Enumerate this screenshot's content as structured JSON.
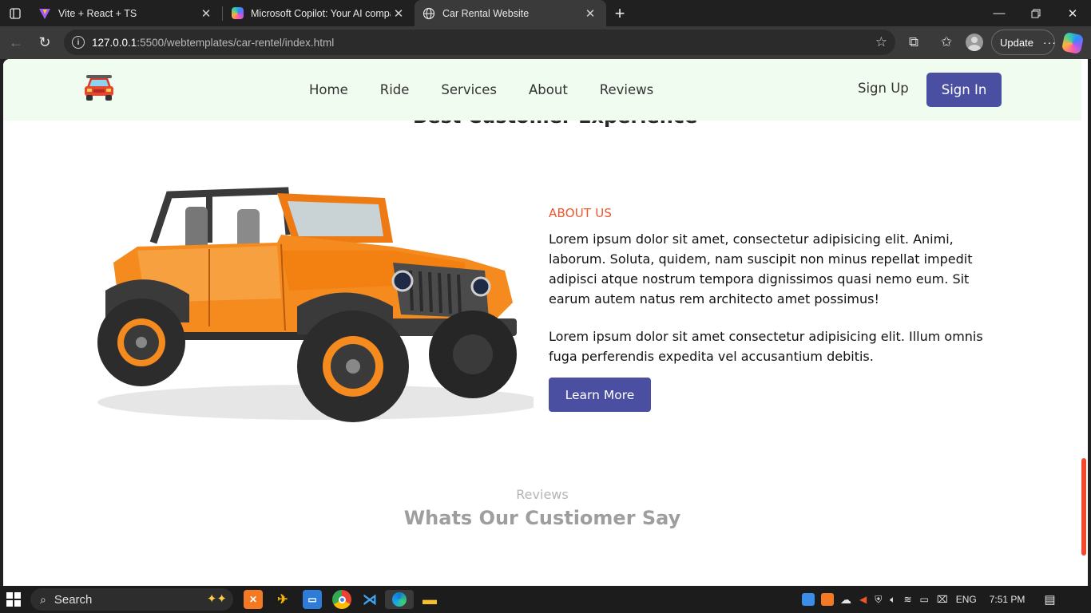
{
  "browser": {
    "tabs": [
      {
        "title": "Vite + React + TS",
        "icon": "vite-icon"
      },
      {
        "title": "Microsoft Copilot: Your AI compa",
        "icon": "copilot-icon"
      },
      {
        "title": "Car Rental Website",
        "icon": "globe-icon",
        "active": true
      }
    ],
    "url_host": "127.0.0.1",
    "url_rest": ":5500/webtemplates/car-rentel/index.html",
    "update_label": "Update"
  },
  "site": {
    "nav": [
      "Home",
      "Ride",
      "Services",
      "About",
      "Reviews"
    ],
    "signup": "Sign Up",
    "signin": "Sign In",
    "peek_heading": "Best Customer Experience",
    "about_label": "ABOUT US",
    "about_p1": "Lorem ipsum dolor sit amet, consectetur adipisicing elit. Animi, laborum. Soluta, quidem, nam suscipit non minus repellat impedit adipisci atque nostrum tempora dignissimos quasi nemo eum. Sit earum autem natus rem architecto amet possimus!",
    "about_p2": "Lorem ipsum dolor sit amet consectetur adipisicing elit. Illum omnis fuga perferendis expedita vel accusantium debitis.",
    "learn_more": "Learn More",
    "reviews_kicker": "Reviews",
    "reviews_title": "Whats Our Custiomer Say"
  },
  "taskbar": {
    "search_label": "Search",
    "language": "ENG",
    "time": "7:51 PM"
  },
  "colors": {
    "accent": "#4a4fa2",
    "about_label": "#f0542d",
    "nav_bg": "#effcef",
    "jeep_body": "#f58a1f"
  }
}
